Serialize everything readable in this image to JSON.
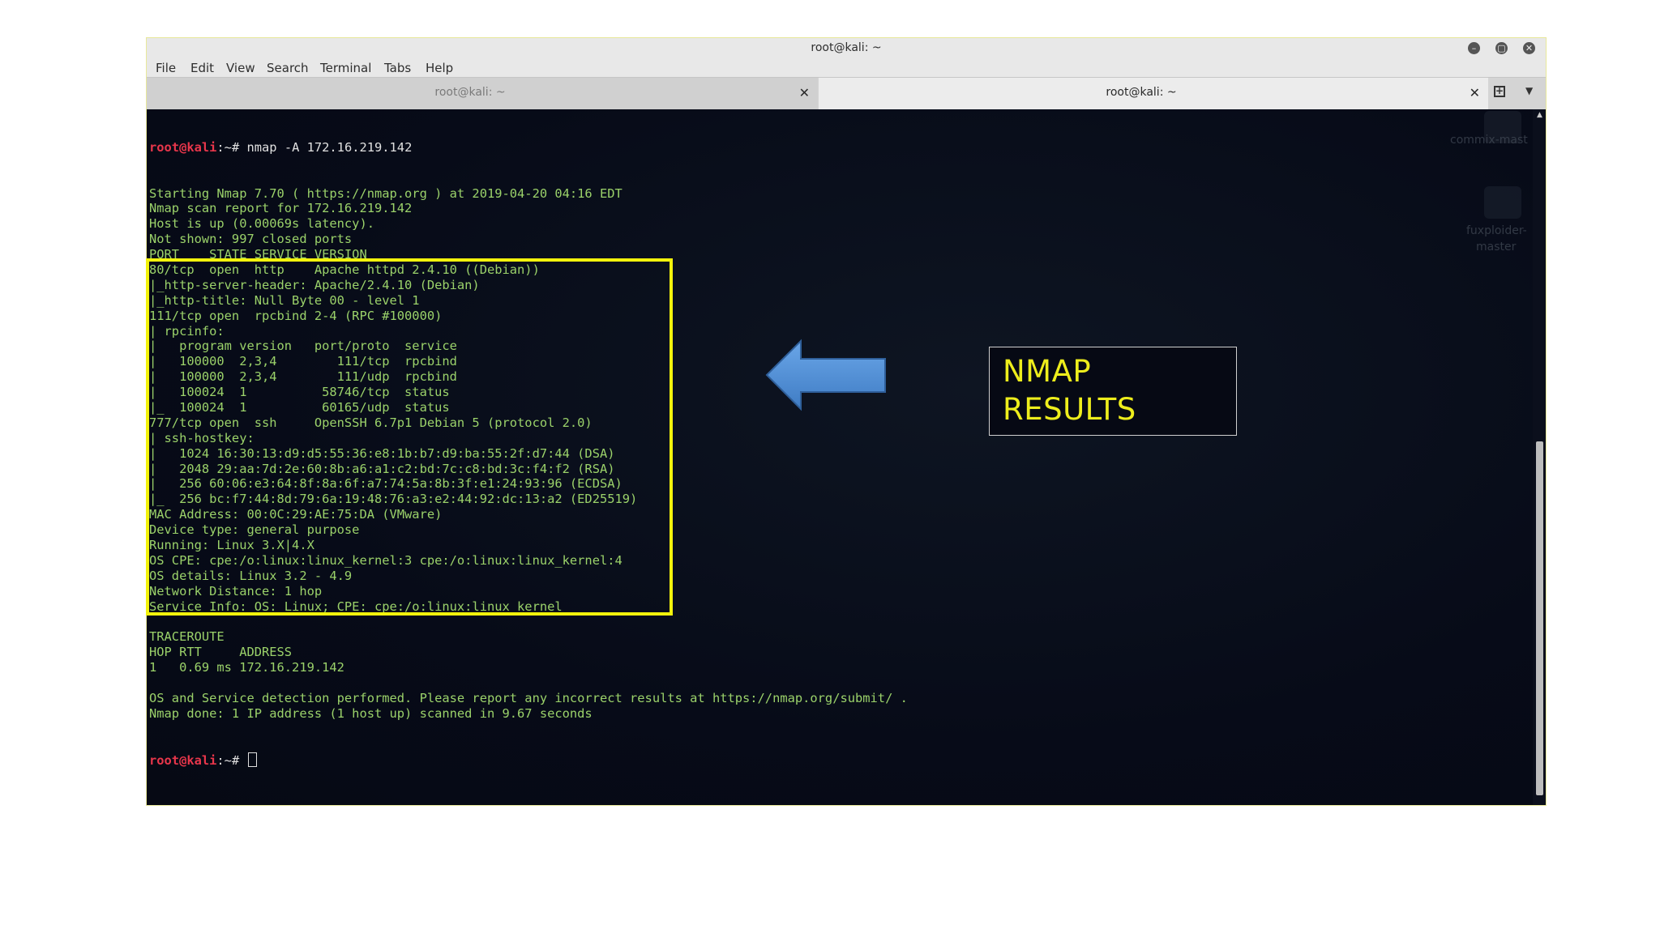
{
  "window": {
    "title": "root@kali: ~",
    "controls": {
      "minimize": "–",
      "maximize": "▢",
      "close": "✕"
    }
  },
  "menu": [
    "File",
    "Edit",
    "View",
    "Search",
    "Terminal",
    "Tabs",
    "Help"
  ],
  "tabs": [
    {
      "label": "root@kali: ~",
      "close": "✕",
      "active": false
    },
    {
      "label": "root@kali: ~",
      "close": "✕",
      "active": true
    }
  ],
  "tabbar_icons": {
    "new_tab": "+",
    "menu": "▼"
  },
  "prompt": {
    "user": "root@kali",
    "path": ":~# "
  },
  "command": "nmap -A 172.16.219.142",
  "output": [
    "Starting Nmap 7.70 ( https://nmap.org ) at 2019-04-20 04:16 EDT",
    "Nmap scan report for 172.16.219.142",
    "Host is up (0.00069s latency).",
    "Not shown: 997 closed ports",
    "PORT    STATE SERVICE VERSION",
    "80/tcp  open  http    Apache httpd 2.4.10 ((Debian))",
    "|_http-server-header: Apache/2.4.10 (Debian)",
    "|_http-title: Null Byte 00 - level 1",
    "111/tcp open  rpcbind 2-4 (RPC #100000)",
    "| rpcinfo:",
    "|   program version   port/proto  service",
    "|   100000  2,3,4        111/tcp  rpcbind",
    "|   100000  2,3,4        111/udp  rpcbind",
    "|   100024  1          58746/tcp  status",
    "|_  100024  1          60165/udp  status",
    "777/tcp open  ssh     OpenSSH 6.7p1 Debian 5 (protocol 2.0)",
    "| ssh-hostkey:",
    "|   1024 16:30:13:d9:d5:55:36:e8:1b:b7:d9:ba:55:2f:d7:44 (DSA)",
    "|   2048 29:aa:7d:2e:60:8b:a6:a1:c2:bd:7c:c8:bd:3c:f4:f2 (RSA)",
    "|   256 60:06:e3:64:8f:8a:6f:a7:74:5a:8b:3f:e1:24:93:96 (ECDSA)",
    "|_  256 bc:f7:44:8d:79:6a:19:48:76:a3:e2:44:92:dc:13:a2 (ED25519)",
    "MAC Address: 00:0C:29:AE:75:DA (VMware)",
    "Device type: general purpose",
    "Running: Linux 3.X|4.X",
    "OS CPE: cpe:/o:linux:linux_kernel:3 cpe:/o:linux:linux_kernel:4",
    "OS details: Linux 3.2 - 4.9",
    "Network Distance: 1 hop",
    "Service Info: OS: Linux; CPE: cpe:/o:linux:linux_kernel",
    "",
    "TRACEROUTE",
    "HOP RTT     ADDRESS",
    "1   0.69 ms 172.16.219.142",
    "",
    "OS and Service detection performed. Please report any incorrect results at https://nmap.org/submit/ .",
    "Nmap done: 1 IP address (1 host up) scanned in 9.67 seconds"
  ],
  "desktop_icons": [
    {
      "label": "commix-mast"
    },
    {
      "label_line1": "fuxploider-",
      "label_line2": "master"
    }
  ],
  "annotation": {
    "line1": "NMAP",
    "line2": "RESULTS",
    "color": "#eded1c",
    "highlight_color": "#f2f20c",
    "arrow_color": "#4f8fd6"
  },
  "colors": {
    "terminal_bg": "#070b1a",
    "terminal_text": "#9bd26a",
    "prompt_user": "#e8364b"
  }
}
